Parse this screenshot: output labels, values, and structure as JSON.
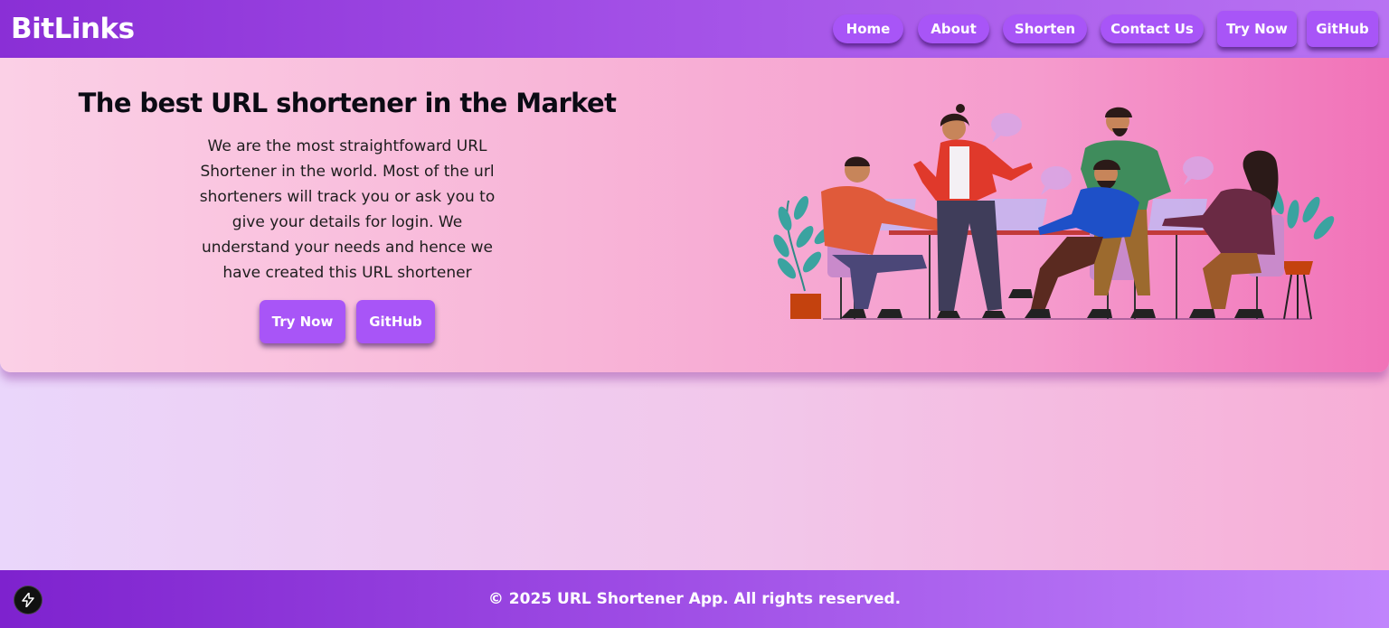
{
  "nav": {
    "brand": "BitLinks",
    "links": [
      "Home",
      "About",
      "Shorten",
      "Contact Us"
    ],
    "try_now": "Try Now",
    "github": "GitHub"
  },
  "hero": {
    "title": "The best URL shortener in the Market",
    "description": "We are the most straightfoward URL Shortener in the world. Most of the url shorteners will track you or ask you to give your details for login. We understand your needs and hence we have created this URL shortener",
    "try_now": "Try Now",
    "github": "GitHub",
    "illustration": "team-meeting-illustration"
  },
  "footer": {
    "text": "© 2025 URL Shortener App. All rights reserved."
  },
  "dev_badge_icon": "lightning-icon",
  "colors": {
    "accent": "#a855f7",
    "nav_start": "#8a2fd6",
    "footer_start": "#7e22ce",
    "hero_end": "#f172b8"
  }
}
